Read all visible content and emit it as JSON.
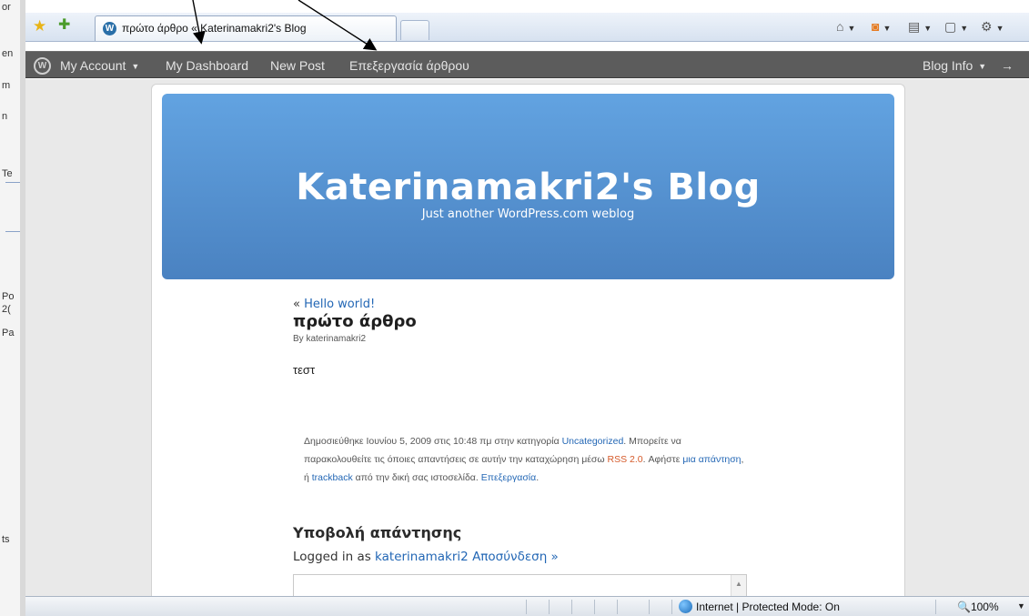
{
  "browser": {
    "tab_title": "πρώτο άρθρο « Katerinamakri2's Blog",
    "cmd_icons": [
      "home-icon",
      "rss-feeds-icon",
      "print-icon",
      "page-icon",
      "tools-icon"
    ]
  },
  "adminbar": {
    "my_account": "My Account",
    "my_dashboard": "My Dashboard",
    "new_post": "New Post",
    "edit_post": "Επεξεργασία άρθρου",
    "blog_info": "Blog Info",
    "arrow": "→"
  },
  "blog": {
    "title": "Katerinamakri2's Blog",
    "tagline": "Just another WordPress.com weblog"
  },
  "post": {
    "prev_prefix": "« ",
    "prev_link": "Hello world!",
    "title": "πρώτο άρθρο",
    "byline": "By katerinamakri2",
    "body": "τεστ",
    "meta": {
      "part1": "Δημοσιεύθηκε Ιουνίου 5, 2009 στις 10:48 πμ στην κατηγορία ",
      "category": "Uncategorized",
      "part2": ". Μπορείτε να παρακολουθείτε τις όποιες απαντήσεις σε αυτήν την καταχώρηση μέσω ",
      "rss": "RSS 2.0",
      "part3": ". Αφήστε ",
      "reply_link": "μια απάντηση",
      "part4": ", ή ",
      "trackback": "trackback",
      "part5": " από την δική σας ιστοσελίδα. ",
      "edit_link": "Επεξεργασία",
      "part6": "."
    }
  },
  "reply": {
    "title": "Υποβολή απάντησης",
    "logged_prefix": "Logged in as ",
    "user_link": "katerinamakri2",
    "logout_link": "Αποσύνδεση »"
  },
  "statusbar": {
    "zone": "Internet | Protected Mode: On",
    "zoom": "100%"
  },
  "left_fragments": [
    "or",
    "en",
    "m",
    "n",
    "Te",
    "Po",
    "2(",
    "Pa",
    "ts"
  ],
  "colors": {
    "adminbar": "#5c5c5c",
    "header_top": "#62a3e1",
    "header_bottom": "#4a82c1",
    "link": "#2367b5",
    "rss": "#d55a2a"
  }
}
